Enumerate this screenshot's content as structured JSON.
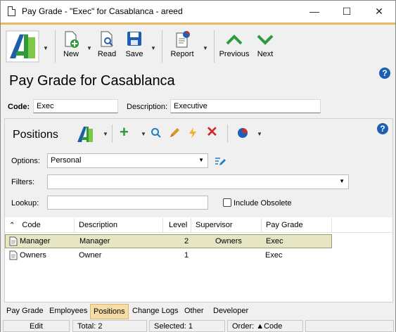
{
  "window": {
    "title": "Pay Grade - \"Exec\" for Casablanca - areed",
    "minimize": "—",
    "maximize": "☐",
    "close": "✕"
  },
  "toolbar": {
    "new_label": "New",
    "read_label": "Read",
    "save_label": "Save",
    "report_label": "Report",
    "previous_label": "Previous",
    "next_label": "Next"
  },
  "header": {
    "title": "Pay Grade for Casablanca",
    "code_label": "Code:",
    "code_value": "Exec",
    "description_label": "Description:",
    "description_value": "Executive",
    "help": "?"
  },
  "positions": {
    "title": "Positions",
    "help": "?",
    "options_label": "Options:",
    "options_value": "Personal",
    "filters_label": "Filters:",
    "filters_value": "",
    "lookup_label": "Lookup:",
    "lookup_value": "",
    "include_obsolete_label": "Include Obsolete",
    "include_obsolete_checked": false,
    "columns": [
      "Code",
      "Description",
      "Level",
      "Supervisor",
      "Pay Grade"
    ],
    "rows": [
      {
        "code": "Manager",
        "description": "Manager",
        "level": "2",
        "supervisor": "Owners",
        "pay_grade": "Exec"
      },
      {
        "code": "Owners",
        "description": "Owner",
        "level": "1",
        "supervisor": "",
        "pay_grade": "Exec"
      }
    ]
  },
  "tabs": [
    "Pay Grade",
    "Employees",
    "Positions",
    "Change Logs",
    "Other",
    "Developer"
  ],
  "status": {
    "mode": "Edit",
    "total": "Total: 2",
    "selected": "Selected: 1",
    "order": "Order: ▲Code"
  },
  "colors": {
    "accent": "#e8b960",
    "selected_row": "#e6e6c4",
    "active_tab": "#f6dca6",
    "green": "#2e9a3a",
    "red": "#d12b2b",
    "help_blue": "#1c5fb4"
  }
}
